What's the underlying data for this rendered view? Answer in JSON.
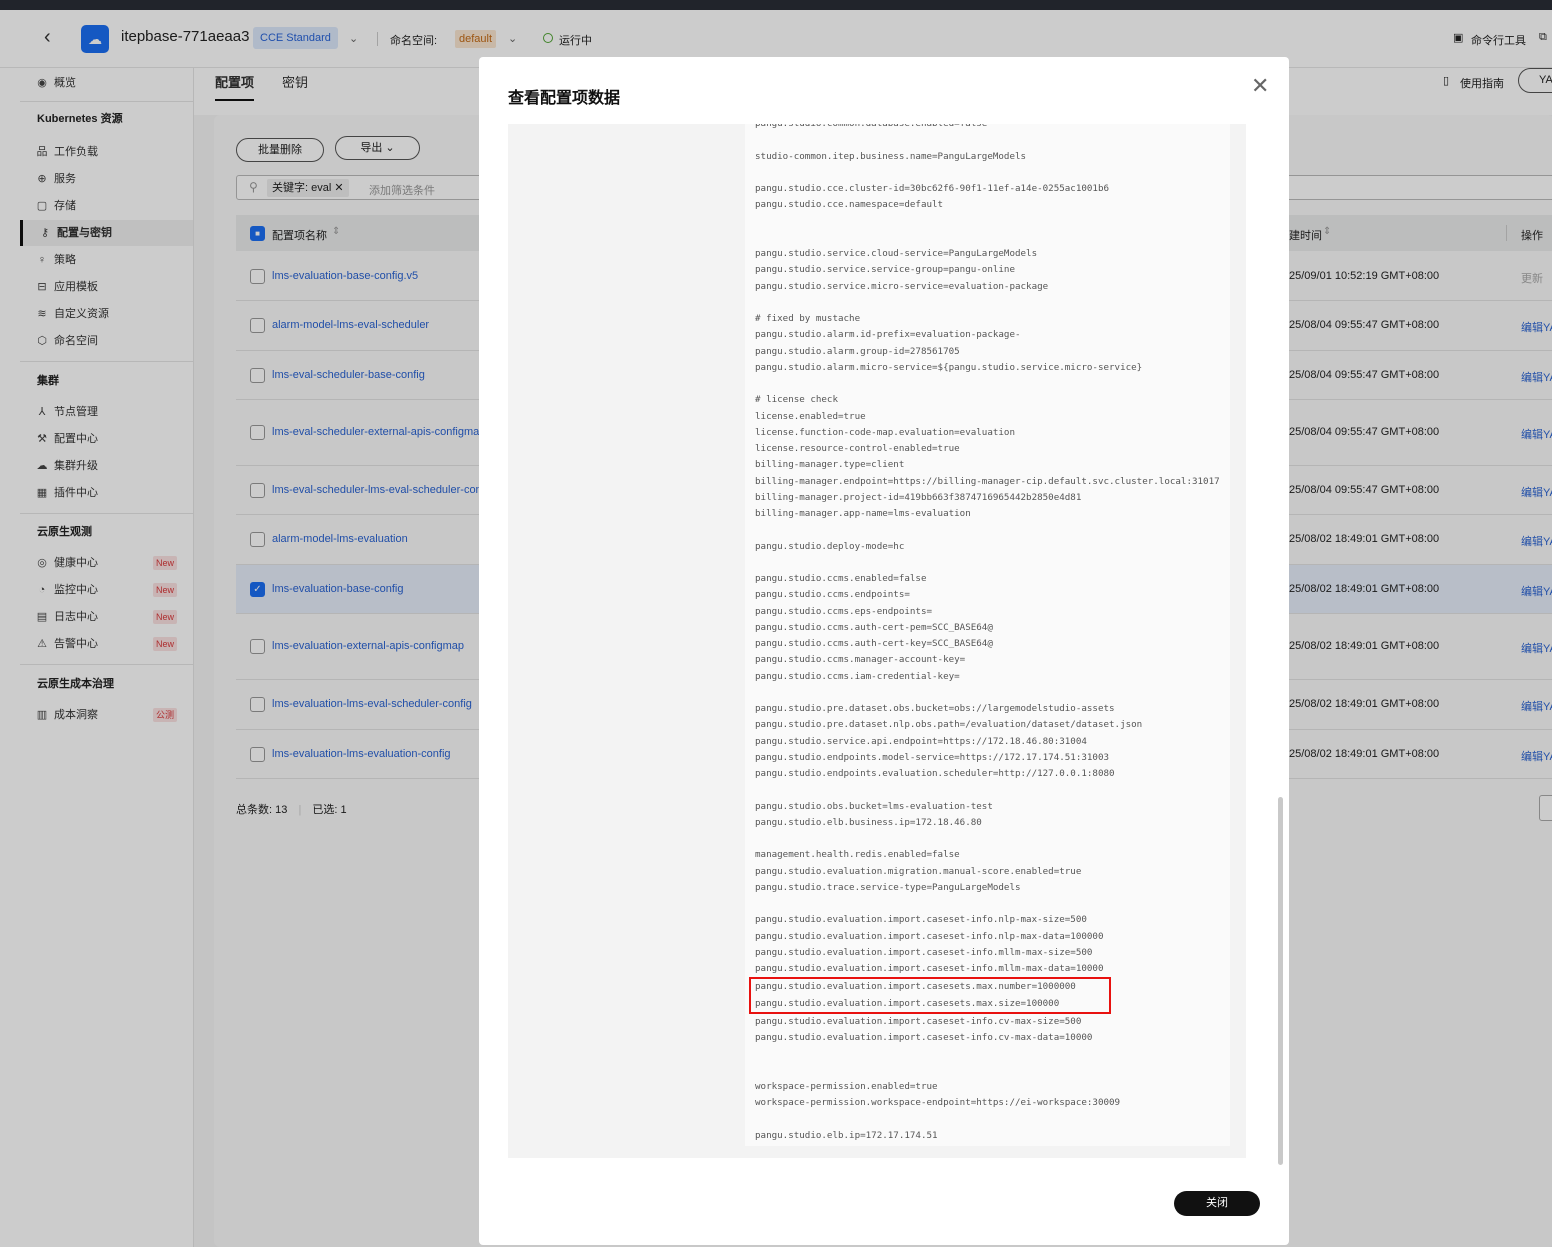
{
  "header": {
    "cluster_name": "itepbase-771aeaa3",
    "edition": "CCE Standard",
    "namespace_label": "命名空间:",
    "namespace": "default",
    "status": "运行中",
    "cli_tool": "命令行工具"
  },
  "sidebar": {
    "overview": "概览",
    "sections": [
      {
        "title": "Kubernetes 资源",
        "items": [
          {
            "label": "工作负载",
            "icon": "workload-icon",
            "glyph": "品"
          },
          {
            "label": "服务",
            "icon": "globe-icon",
            "glyph": "⊕"
          },
          {
            "label": "存储",
            "icon": "storage-icon",
            "glyph": "▢"
          },
          {
            "label": "配置与密钥",
            "icon": "key-icon",
            "glyph": "⚷",
            "active": true
          },
          {
            "label": "策略",
            "icon": "bulb-icon",
            "glyph": "♀"
          },
          {
            "label": "应用模板",
            "icon": "template-icon",
            "glyph": "⊟"
          },
          {
            "label": "自定义资源",
            "icon": "layers-icon",
            "glyph": "≋"
          },
          {
            "label": "命名空间",
            "icon": "cube-icon",
            "glyph": "⬡"
          }
        ]
      },
      {
        "title": "集群",
        "items": [
          {
            "label": "节点管理",
            "icon": "nodes-icon",
            "glyph": "⅄"
          },
          {
            "label": "配置中心",
            "icon": "wrench-icon",
            "glyph": "⚒"
          },
          {
            "label": "集群升级",
            "icon": "cloud-upload-icon",
            "glyph": "☁"
          },
          {
            "label": "插件中心",
            "icon": "grid-icon",
            "glyph": "▦"
          }
        ]
      },
      {
        "title": "云原生观测",
        "items": [
          {
            "label": "健康中心",
            "icon": "health-icon",
            "glyph": "◎",
            "badge": "New"
          },
          {
            "label": "监控中心",
            "icon": "pie-icon",
            "glyph": "◔",
            "badge": "New"
          },
          {
            "label": "日志中心",
            "icon": "log-icon",
            "glyph": "▤",
            "badge": "New"
          },
          {
            "label": "告警中心",
            "icon": "alarm-icon",
            "glyph": "⚠",
            "badge": "New"
          }
        ]
      },
      {
        "title": "云原生成本治理",
        "items": [
          {
            "label": "成本洞察",
            "icon": "chart-icon",
            "glyph": "▥",
            "badge": "公测"
          }
        ]
      }
    ]
  },
  "main": {
    "tabs": [
      "配置项",
      "密钥"
    ],
    "guide": "使用指南",
    "yaml_button": "YAML",
    "batch_delete": "批量删除",
    "export": "导出",
    "filter_tag": "关键字: eval",
    "filter_placeholder": "添加筛选条件",
    "columns": {
      "name": "配置项名称",
      "time": "建时间",
      "ops": "操作"
    },
    "rows": [
      {
        "name": "lms-evaluation-base-config.v5",
        "time": "25/09/01 10:52:19 GMT+08:00",
        "action": "更新",
        "disabled": true
      },
      {
        "name": "alarm-model-lms-eval-scheduler",
        "time": "25/08/04 09:55:47 GMT+08:00",
        "action": "编辑YAML"
      },
      {
        "name": "lms-eval-scheduler-base-config",
        "time": "25/08/04 09:55:47 GMT+08:00",
        "action": "编辑YAML"
      },
      {
        "name": "lms-eval-scheduler-external-apis-configmap",
        "time": "25/08/04 09:55:47 GMT+08:00",
        "action": "编辑YAML"
      },
      {
        "name": "lms-eval-scheduler-lms-eval-scheduler-config",
        "time": "25/08/04 09:55:47 GMT+08:00",
        "action": "编辑YAML"
      },
      {
        "name": "alarm-model-lms-evaluation",
        "time": "25/08/02 18:49:01 GMT+08:00",
        "action": "编辑YAML"
      },
      {
        "name": "lms-evaluation-base-config",
        "time": "25/08/02 18:49:01 GMT+08:00",
        "action": "编辑YAML",
        "selected": true
      },
      {
        "name": "lms-evaluation-external-apis-configmap",
        "time": "25/08/02 18:49:01 GMT+08:00",
        "action": "编辑YAML"
      },
      {
        "name": "lms-evaluation-lms-eval-scheduler-config",
        "time": "25/08/02 18:49:01 GMT+08:00",
        "action": "编辑YAML"
      },
      {
        "name": "lms-evaluation-lms-evaluation-config",
        "time": "25/08/02 18:49:01 GMT+08:00",
        "action": "编辑YAML"
      }
    ],
    "total_label": "总条数:",
    "total": "13",
    "selected_label": "已选:",
    "selected": "1"
  },
  "modal": {
    "title": "查看配置项数据",
    "close_label": "关闭",
    "highlight_color": "#e8110f",
    "highlight_range": [
      53,
      54
    ],
    "lines": [
      "pangu.studio.common.database.enabled=false",
      "",
      "studio-common.itep.business.name=PanguLargeModels",
      "",
      "pangu.studio.cce.cluster-id=30bc62f6-90f1-11ef-a14e-0255ac1001b6",
      "pangu.studio.cce.namespace=default",
      "",
      "",
      "pangu.studio.service.cloud-service=PanguLargeModels",
      "pangu.studio.service.service-group=pangu-online",
      "pangu.studio.service.micro-service=evaluation-package",
      "",
      "# fixed by mustache",
      "pangu.studio.alarm.id-prefix=evaluation-package-",
      "pangu.studio.alarm.group-id=278561705",
      "pangu.studio.alarm.micro-service=${pangu.studio.service.micro-service}",
      "",
      "# license check",
      "license.enabled=true",
      "license.function-code-map.evaluation=evaluation",
      "license.resource-control-enabled=true",
      "billing-manager.type=client",
      "billing-manager.endpoint=https://billing-manager-cip.default.svc.cluster.local:31017",
      "billing-manager.project-id=419bb663f3874716965442b2850e4d81",
      "billing-manager.app-name=lms-evaluation",
      "",
      "pangu.studio.deploy-mode=hc",
      "",
      "pangu.studio.ccms.enabled=false",
      "pangu.studio.ccms.endpoints=",
      "pangu.studio.ccms.eps-endpoints=",
      "pangu.studio.ccms.auth-cert-pem=SCC_BASE64@",
      "pangu.studio.ccms.auth-cert-key=SCC_BASE64@",
      "pangu.studio.ccms.manager-account-key=",
      "pangu.studio.ccms.iam-credential-key=",
      "",
      "pangu.studio.pre.dataset.obs.bucket=obs://largemodelstudio-assets",
      "pangu.studio.pre.dataset.nlp.obs.path=/evaluation/dataset/dataset.json",
      "pangu.studio.service.api.endpoint=https://172.18.46.80:31004",
      "pangu.studio.endpoints.model-service=https://172.17.174.51:31003",
      "pangu.studio.endpoints.evaluation.scheduler=http://127.0.0.1:8080",
      "",
      "pangu.studio.obs.bucket=lms-evaluation-test",
      "pangu.studio.elb.business.ip=172.18.46.80",
      "",
      "management.health.redis.enabled=false",
      "pangu.studio.evaluation.migration.manual-score.enabled=true",
      "pangu.studio.trace.service-type=PanguLargeModels",
      "",
      "pangu.studio.evaluation.import.caseset-info.nlp-max-size=500",
      "pangu.studio.evaluation.import.caseset-info.nlp-max-data=100000",
      "pangu.studio.evaluation.import.caseset-info.mllm-max-size=500",
      "pangu.studio.evaluation.import.caseset-info.mllm-max-data=10000",
      "pangu.studio.evaluation.import.casesets.max.number=1000000",
      "pangu.studio.evaluation.import.casesets.max.size=100000",
      "pangu.studio.evaluation.import.caseset-info.cv-max-size=500",
      "pangu.studio.evaluation.import.caseset-info.cv-max-data=10000",
      "",
      "",
      "workspace-permission.enabled=true",
      "workspace-permission.workspace-endpoint=https://ei-workspace:30009",
      "",
      "pangu.studio.elb.ip=172.17.174.51"
    ]
  }
}
